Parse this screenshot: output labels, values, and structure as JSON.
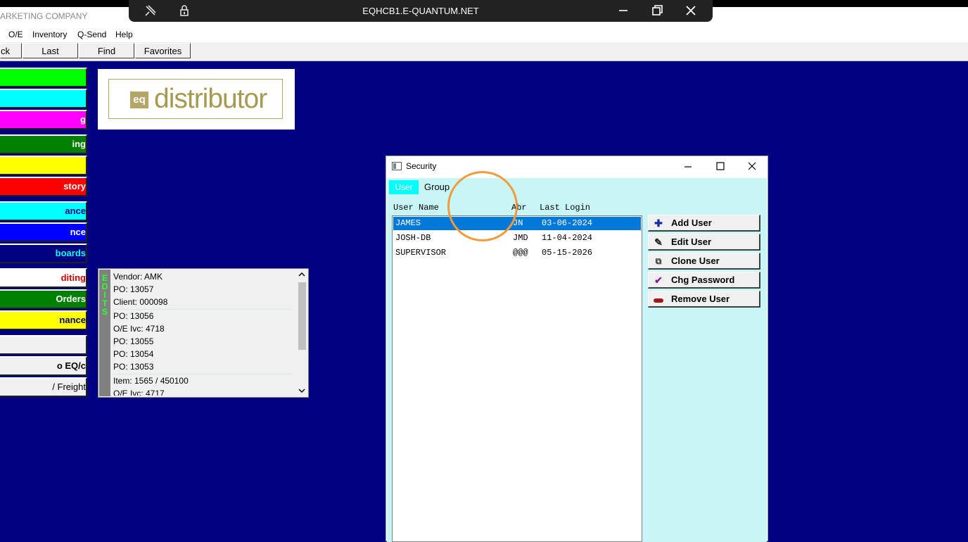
{
  "app": {
    "company": "ARKETING COMPANY"
  },
  "remote": {
    "title": "EQHCB1.E-QUANTUM.NET"
  },
  "menu": [
    "O/E",
    "Inventory",
    "Q-Send",
    "Help"
  ],
  "toolbar": {
    "back": "ck",
    "last": "Last",
    "find": "Find",
    "favorites": "Favorites"
  },
  "sidebar": [
    {
      "label": "",
      "color": "#00ff00",
      "text_color": "#000000"
    },
    {
      "label": "",
      "color": "#00ffff",
      "text_color": "#000000"
    },
    {
      "label": "g",
      "color": "#ff00ff",
      "text_color": "#ffffff"
    },
    {
      "label": "ing",
      "color": "#008000",
      "text_color": "#ffffff"
    },
    {
      "label": "",
      "color": "#ffff00",
      "text_color": "#000000"
    },
    {
      "label": "story",
      "color": "#ff0000",
      "text_color": "#ffffff"
    },
    {
      "label": "ance",
      "color": "#00ffff",
      "text_color": "#000080"
    },
    {
      "label": "nce",
      "color": "#0000ff",
      "text_color": "#ffffff"
    },
    {
      "label": "boards",
      "color": "#000080",
      "text_color": "#00ffff"
    },
    {
      "label": "diting",
      "color": "#ffffff",
      "text_color": "#d00000"
    },
    {
      "label": "Orders",
      "color": "#008000",
      "text_color": "#ffffff"
    },
    {
      "label": "nance",
      "color": "#ffff00",
      "text_color": "#000080"
    },
    {
      "label": "",
      "color": "#f0f0f0",
      "text_color": "#000000"
    },
    {
      "label": "o EQ/c",
      "color": "#f0f0f0",
      "text_color": "#000000"
    },
    {
      "label": "/ Freight",
      "color": "#f0f0f0",
      "text_color": "#000000"
    }
  ],
  "logo": {
    "badge": "eq",
    "text": "distributor"
  },
  "edits": {
    "side_label": [
      "E",
      "D",
      "I",
      "T",
      "S"
    ],
    "items": [
      "Vendor: AMK",
      "PO: 13057",
      "Client: 000098",
      "PO: 13056",
      "O/E Ivc: 4718",
      "PO: 13055",
      "PO: 13054",
      "PO: 13053",
      "Item: 1565 / 450100",
      "O/E Ivc: 4717"
    ]
  },
  "security": {
    "title": "Security",
    "tabs": {
      "user": "User",
      "group": "Group"
    },
    "columns": {
      "user_name": "User Name",
      "abbr": "Abr",
      "last_login": "Last Login"
    },
    "users": [
      {
        "name": "JAMES",
        "abbr": "JN",
        "last_login": "03-06-2024",
        "selected": true
      },
      {
        "name": "JOSH-DB",
        "abbr": "JMD",
        "last_login": "11-04-2024",
        "selected": false
      },
      {
        "name": "SUPERVISOR",
        "abbr": "@@@",
        "last_login": "05-15-2026",
        "selected": false
      }
    ],
    "actions": {
      "add": "Add User",
      "edit": "Edit User",
      "clone": "Clone User",
      "chg_password": "Chg Password",
      "remove": "Remove User"
    }
  }
}
